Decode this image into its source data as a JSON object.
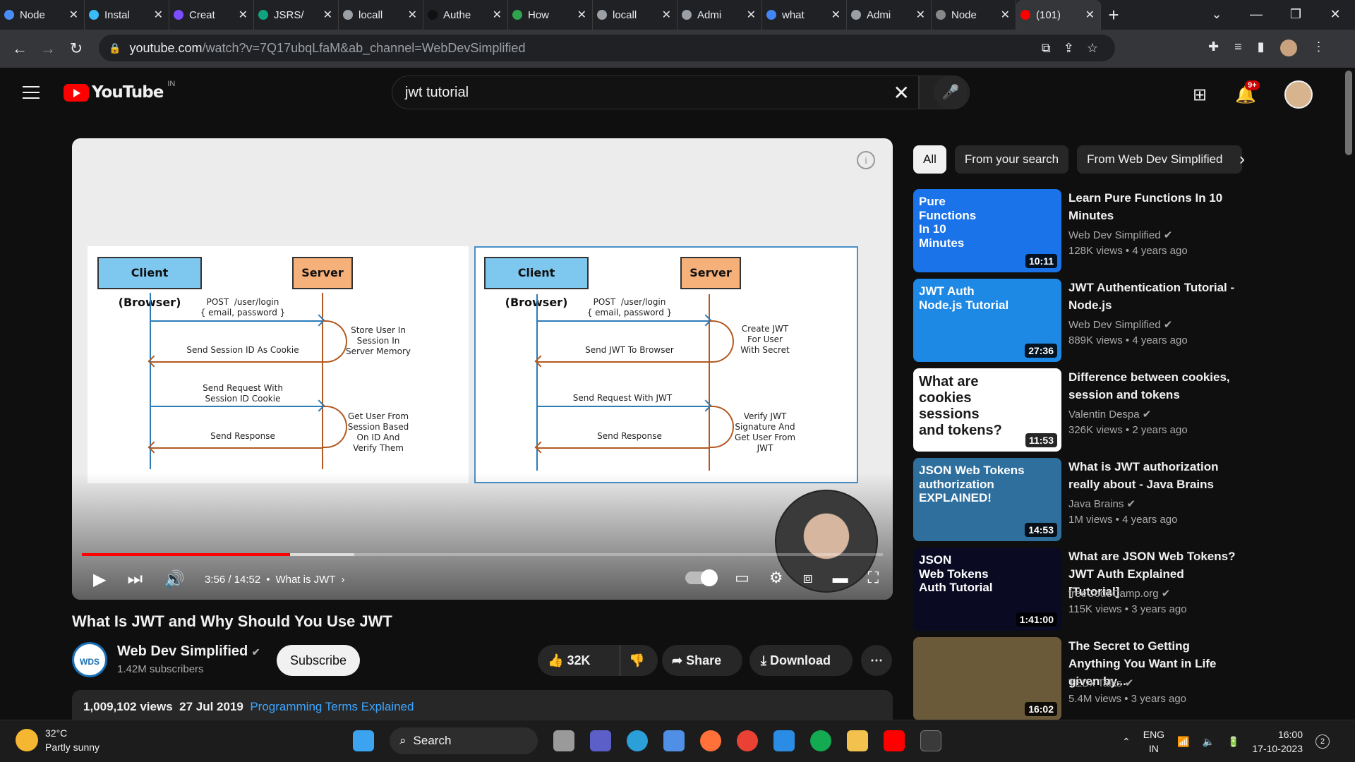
{
  "browser": {
    "tabs": [
      {
        "title": "Node",
        "color": "#4a8df7"
      },
      {
        "title": "Instal",
        "color": "#38bdf8"
      },
      {
        "title": "Creat",
        "color": "#7c4dff"
      },
      {
        "title": "JSRS/",
        "color": "#10a37f"
      },
      {
        "title": "locall",
        "color": "#9aa0a6"
      },
      {
        "title": "Authe",
        "color": "#111111"
      },
      {
        "title": "How",
        "color": "#2ea44f"
      },
      {
        "title": "locall",
        "color": "#9aa0a6"
      },
      {
        "title": "Admi",
        "color": "#9aa0a6"
      },
      {
        "title": "what",
        "color": "#4285f4"
      },
      {
        "title": "Admi",
        "color": "#9aa0a6"
      },
      {
        "title": "Node",
        "color": "#888888"
      },
      {
        "title": "(101)",
        "color": "#ff0000"
      }
    ],
    "url_host": "youtube.com",
    "url_path": "/watch?v=7Q17ubqLfaM&ab_channel=WebDevSimplified"
  },
  "youtube": {
    "logo_text": "YouTube",
    "country": "IN",
    "search_value": "jwt tutorial",
    "notification_count": "9+"
  },
  "diagram": {
    "client_label": "Client (Browser)",
    "server_label": "Server",
    "left": {
      "msg1": "POST  /user/login\n{ email, password }",
      "note1": "Store User In\nSession In\nServer Memory",
      "msg2": "Send Session ID As Cookie",
      "msg3": "Send Request With\nSession ID Cookie",
      "note2": "Get User From\nSession Based\nOn ID And\nVerify Them",
      "msg4": "Send Response"
    },
    "right": {
      "msg1": "POST  /user/login\n{ email, password }",
      "note1": "Create JWT\nFor User\nWith Secret",
      "msg2": "Send JWT To Browser",
      "msg3": "Send Request With JWT",
      "note2": "Verify JWT\nSignature And\nGet User From\nJWT",
      "msg4": "Send Response"
    }
  },
  "player": {
    "time": "3:56 / 14:52",
    "chapter": "What is JWT",
    "played_fraction": 0.26,
    "buffered_fraction": 0.34
  },
  "video": {
    "title": "What Is JWT and Why Should You Use JWT",
    "channel": "Web Dev Simplified",
    "channel_logo": "WDS",
    "subscribers": "1.42M subscribers",
    "subscribe_label": "Subscribe",
    "likes": "32K",
    "share_label": "Share",
    "download_label": "Download",
    "views": "1,009,102 views",
    "date": "27 Jul 2019",
    "tag": "Programming Terms Explained"
  },
  "sidebar": {
    "chips": [
      "All",
      "From your search",
      "From Web Dev Simplified"
    ],
    "recommendations": [
      {
        "title": "Learn Pure Functions In 10 Minutes",
        "channel": "Web Dev Simplified",
        "views": "128K views",
        "age": "4 years ago",
        "duration": "10:11",
        "thumb_text": "Pure\nFunctions\nIn 10\nMinutes",
        "bg": "#1a73e8"
      },
      {
        "title": "JWT Authentication Tutorial - Node.js",
        "channel": "Web Dev Simplified",
        "views": "889K views",
        "age": "4 years ago",
        "duration": "27:36",
        "thumb_text": "JWT Auth\nNode.js Tutorial",
        "bg": "#1e88e5"
      },
      {
        "title": "Difference between cookies, session and tokens",
        "channel": "Valentin Despa",
        "views": "326K views",
        "age": "2 years ago",
        "duration": "11:53",
        "thumb_text": "What are\ncookies\nsessions\nand tokens?",
        "bg": "#ffffff"
      },
      {
        "title": "What is JWT authorization really about - Java Brains",
        "channel": "Java Brains",
        "views": "1M views",
        "age": "4 years ago",
        "duration": "14:53",
        "thumb_text": "JSON Web Tokens\nauthorization\nEXPLAINED!",
        "bg": "#2f6f9e"
      },
      {
        "title": "What are JSON Web Tokens? JWT Auth Explained [Tutorial]",
        "channel": "freeCodeCamp.org",
        "views": "115K views",
        "age": "3 years ago",
        "duration": "1:41:00",
        "thumb_text": "JSON\nWeb Tokens\nAuth Tutorial",
        "bg": "#0a0a23"
      },
      {
        "title": "The Secret to Getting Anything You Want in Life given by...",
        "channel": "TEDx Talks",
        "views": "5.4M views",
        "age": "3 years ago",
        "duration": "16:02",
        "thumb_text": "",
        "bg": "#6b5a3a"
      }
    ]
  },
  "taskbar": {
    "temperature": "32°C",
    "weather": "Partly sunny",
    "search_label": "Search",
    "lang": "ENG",
    "region": "IN",
    "time": "16:00",
    "date": "17-10-2023",
    "notifications": "2"
  }
}
